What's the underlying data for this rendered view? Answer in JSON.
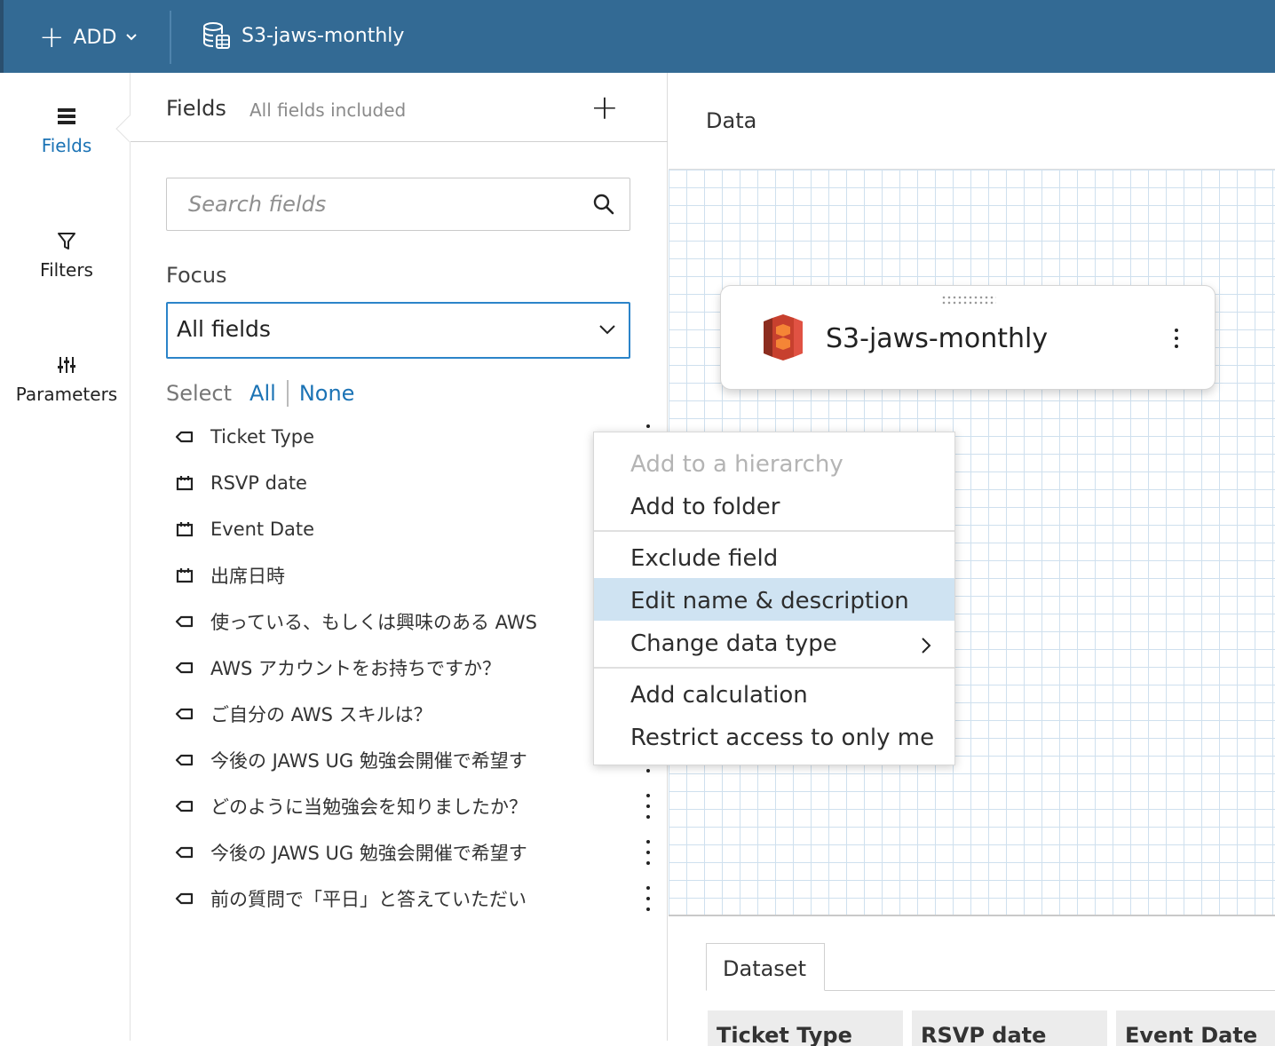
{
  "topbar": {
    "add_label": "ADD",
    "dataset_name": "S3-jaws-monthly"
  },
  "leftnav": {
    "items": [
      {
        "label": "Fields",
        "icon": "fields-icon",
        "active": true
      },
      {
        "label": "Filters",
        "icon": "filter-icon",
        "active": false
      },
      {
        "label": "Parameters",
        "icon": "parameters-icon",
        "active": false
      }
    ]
  },
  "fields_panel": {
    "title": "Fields",
    "subtitle": "All fields included",
    "search_placeholder": "Search fields",
    "focus_label": "Focus",
    "focus_value": "All fields",
    "select_label": "Select",
    "select_all": "All",
    "select_none": "None",
    "fields": [
      {
        "name": "Ticket Type",
        "type": "string-icon"
      },
      {
        "name": "RSVP date",
        "type": "date-icon"
      },
      {
        "name": "Event Date",
        "type": "date-icon"
      },
      {
        "name": "出席日時",
        "type": "date-icon"
      },
      {
        "name": "使っている、もしくは興味のある AWS",
        "type": "string-icon"
      },
      {
        "name": "AWS アカウントをお持ちですか？",
        "type": "string-icon"
      },
      {
        "name": "ご自分の AWS スキルは？",
        "type": "string-icon"
      },
      {
        "name": "今後の JAWS UG 勉強会開催で希望す",
        "type": "string-icon"
      },
      {
        "name": "どのように当勉強会を知りましたか？",
        "type": "string-icon"
      },
      {
        "name": "今後の JAWS UG 勉強会開催で希望す",
        "type": "string-icon"
      },
      {
        "name": "前の質問で「平日」と答えていただい",
        "type": "string-icon"
      }
    ]
  },
  "context_menu": {
    "items": [
      {
        "label": "Add to a hierarchy",
        "disabled": true
      },
      {
        "label": "Add to folder"
      },
      {
        "label": "Exclude field"
      },
      {
        "label": "Edit name & description",
        "highlighted": true
      },
      {
        "label": "Change data type",
        "submenu": true
      },
      {
        "label": "Add calculation"
      },
      {
        "label": "Restrict access to only me"
      }
    ]
  },
  "data_panel": {
    "title": "Data",
    "node_name": "S3-jaws-monthly",
    "dataset_tab": "Dataset",
    "columns": [
      "Ticket Type",
      "RSVP date",
      "Event Date"
    ]
  },
  "colors": {
    "topbar": "#336a94",
    "accent": "#1b73b5",
    "highlight": "#cfe3f2",
    "s3_brand": "#c7402e"
  }
}
